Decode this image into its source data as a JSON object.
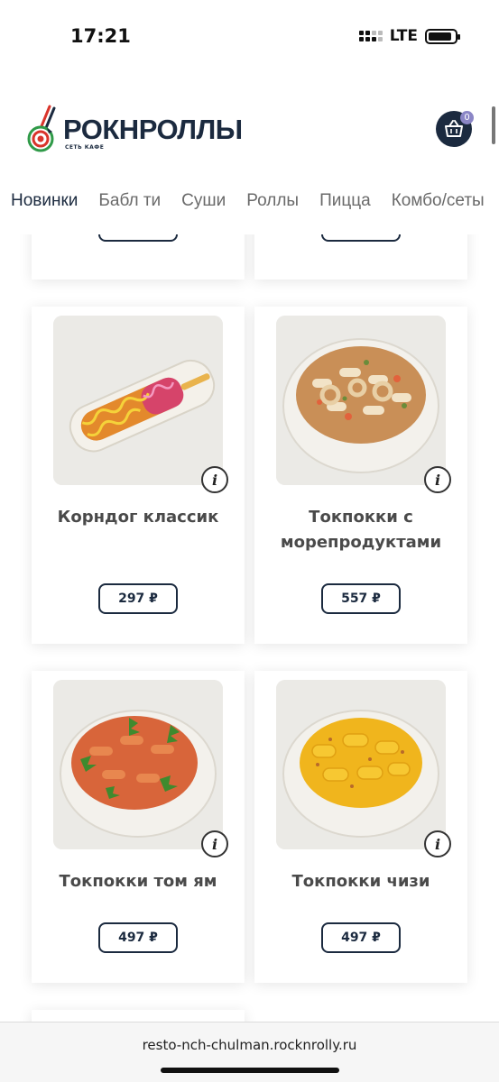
{
  "status_bar": {
    "time": "17:21",
    "network": "LTE",
    "battery_level": 0.9
  },
  "header": {
    "logo_text": "РОКНРОЛЛЫ",
    "logo_subtitle": "СЕТЬ КАФЕ",
    "cart_count": "0",
    "colors": {
      "brand": "#1b2a3f",
      "badge": "#8b86c6",
      "logo_red": "#d9342b",
      "logo_green": "#2f9a48"
    }
  },
  "tabs": [
    {
      "label": "Новинки",
      "active": true
    },
    {
      "label": "Бабл ти",
      "active": false
    },
    {
      "label": "Суши",
      "active": false
    },
    {
      "label": "Роллы",
      "active": false
    },
    {
      "label": "Пицца",
      "active": false
    },
    {
      "label": "Комбо/сеты",
      "active": false
    }
  ],
  "products": [
    {
      "title": "Корндог классик",
      "price": "297 ₽",
      "image": "corndog-dish",
      "info_icon": "info-icon"
    },
    {
      "title": "Токпокки с морепродуктами",
      "price": "557 ₽",
      "image": "seafood-tteokbokki-bowl",
      "info_icon": "info-icon"
    },
    {
      "title": "Токпокки том ям",
      "price": "497 ₽",
      "image": "tom-yum-tteokbokki-bowl",
      "info_icon": "info-icon"
    },
    {
      "title": "Токпокки чизи",
      "price": "497 ₽",
      "image": "cheesy-tteokbokki-bowl",
      "info_icon": "info-icon"
    }
  ],
  "browser": {
    "url": "resto-nch-chulman.rocknrolly.ru"
  }
}
